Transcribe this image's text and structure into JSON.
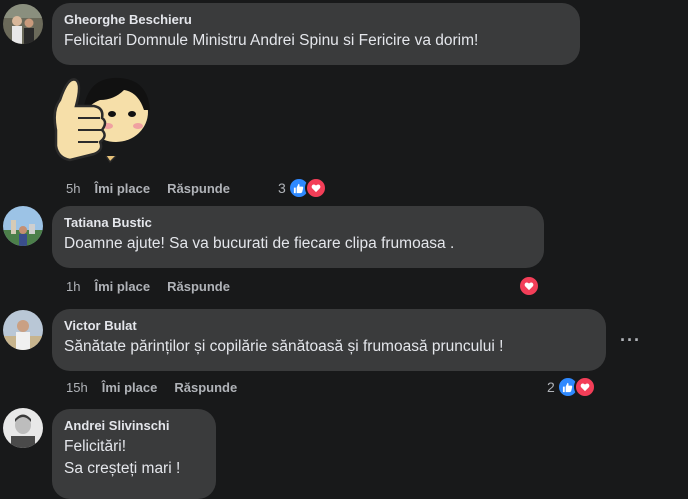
{
  "comments": [
    {
      "author": "Gheorghe Beschieru",
      "text": "Felicitari Domnule Ministru Andrei Spinu si Fericire va dorim!",
      "time": "5h",
      "like_label": "Îmi place",
      "reply_label": "Răspunde",
      "reaction_count": "3",
      "reactions": [
        "like",
        "love"
      ]
    },
    {
      "author": "Tatiana Bustic",
      "text": "Doamne ajute! Sa va bucurati de fiecare clipa frumoasa .",
      "time": "1h",
      "like_label": "Îmi place",
      "reply_label": "Răspunde",
      "reaction_count": "",
      "reactions": [
        "love"
      ]
    },
    {
      "author": "Victor Bulat",
      "text": "Sănătate părinților și copilărie sănătoasă și frumoasă pruncului !",
      "time": "15h",
      "like_label": "Îmi place",
      "reply_label": "Răspunde",
      "reaction_count": "2",
      "reactions": [
        "like",
        "love"
      ],
      "options_label": "···"
    },
    {
      "author": "Andrei Slivinschi",
      "text_lines": [
        "Felicitări!",
        "Sa creșteți mari !"
      ]
    }
  ],
  "colors": {
    "background": "#18191a",
    "bubble": "#3a3b3c",
    "text": "#e4e6eb",
    "secondary": "#b0b3b8",
    "like_blue": "#2e89ff",
    "love_red": "#f33e58"
  }
}
